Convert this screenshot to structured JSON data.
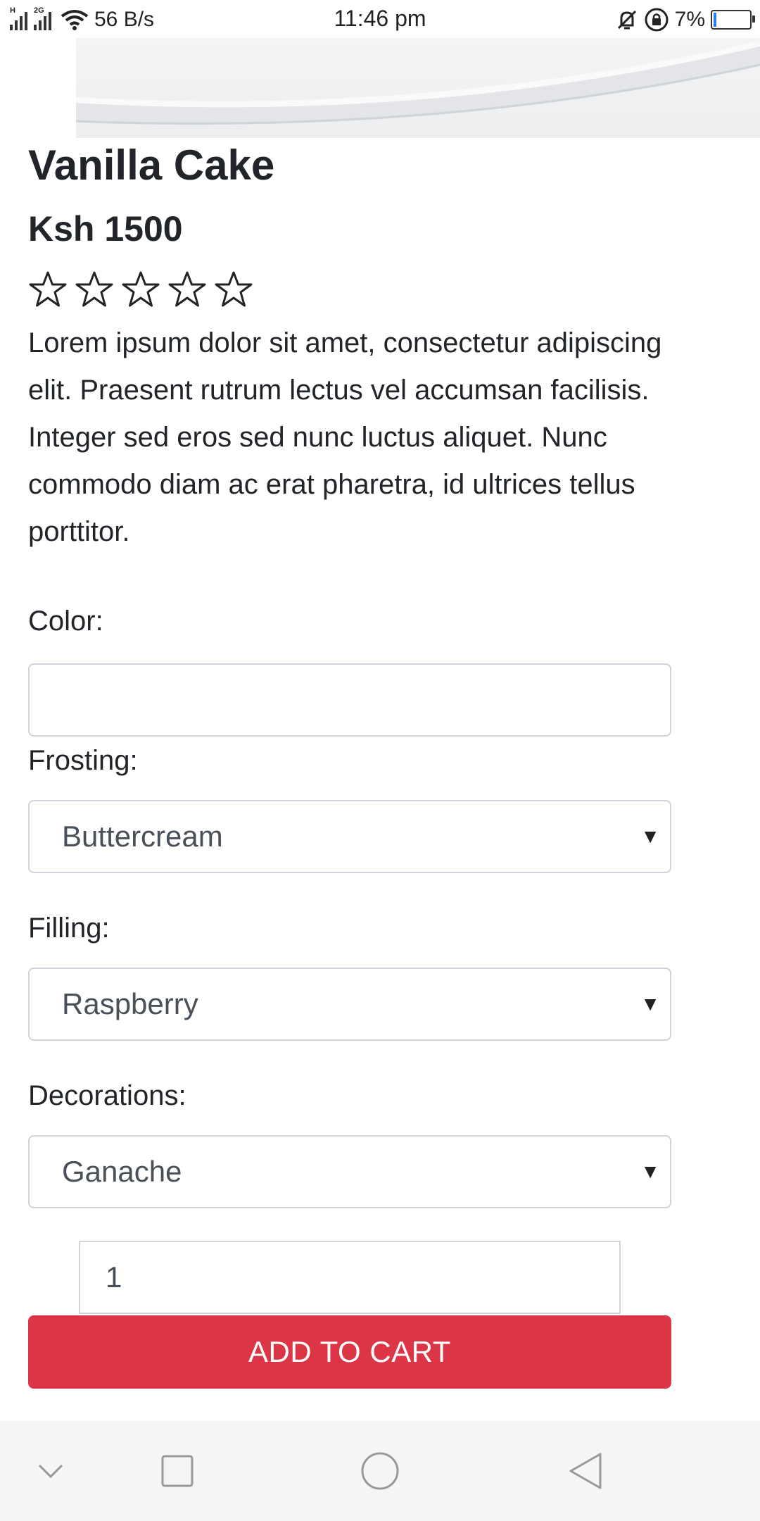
{
  "status_bar": {
    "network_type": "2G",
    "signal_tag": "H",
    "speed": "56 B/s",
    "time": "11:46 pm",
    "battery_percent": "7%",
    "battery_level": 0.07,
    "icons": [
      "signal-icon",
      "wifi-icon",
      "mute-icon",
      "rotation-lock-icon",
      "battery-icon"
    ]
  },
  "product": {
    "title": "Vanilla Cake",
    "price": "Ksh 1500",
    "rating": 0,
    "rating_max": 5,
    "description": "Lorem ipsum dolor sit amet, consectetur adipiscing elit. Praesent rutrum lectus vel accumsan facilisis. Integer sed eros sed nunc luctus aliquet. Nunc commodo diam ac erat pharetra, id ultrices tellus porttitor."
  },
  "form": {
    "color": {
      "label": "Color:",
      "value": ""
    },
    "frosting": {
      "label": "Frosting:",
      "value": "Buttercream"
    },
    "filling": {
      "label": "Filling:",
      "value": "Raspberry"
    },
    "decorations": {
      "label": "Decorations:",
      "value": "Ganache"
    },
    "quantity": "1",
    "add_to_cart_label": "ADD TO CART"
  },
  "colors": {
    "accent_button": "#dc3545",
    "border": "#ced4da",
    "text": "#212529",
    "navbar_bg": "#f5f5f5"
  },
  "nav_bar": {
    "icons": [
      "chevron-down-icon",
      "recents-square-icon",
      "home-circle-icon",
      "back-triangle-icon"
    ]
  }
}
